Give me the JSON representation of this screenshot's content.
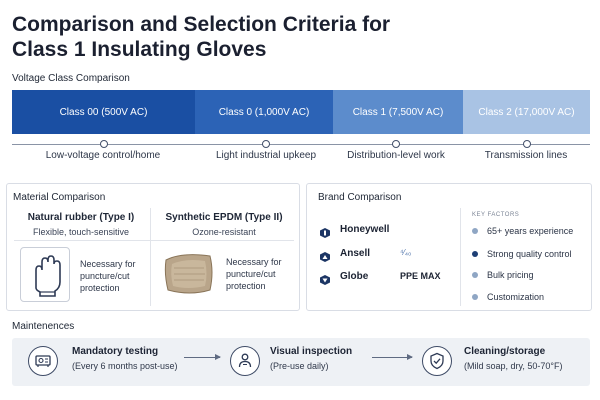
{
  "title": "Comparison and Selection Criteria for Class 1 Insulating Gloves",
  "voltage": {
    "label": "Voltage Class Comparison",
    "classes": [
      {
        "label": "Class 00 (500V AC)",
        "color": "#1a4fa3",
        "use": "Low-voltage control/home"
      },
      {
        "label": "Class 0 (1,000V AC)",
        "color": "#2c63b6",
        "use": "Light industrial upkeep"
      },
      {
        "label": "Class 1 (7,500V AC)",
        "color": "#5c8ccc",
        "use": "Distribution-level work"
      },
      {
        "label": "Class 2 (17,000V AC)",
        "color": "#a9c3e4",
        "use": "Transmission lines"
      }
    ]
  },
  "material": {
    "label": "Material Comparison",
    "types": [
      {
        "name": "Natural rubber (Type I)",
        "property": "Flexible, touch-sensitive",
        "icon": "glove-icon",
        "note": [
          "Necessary for",
          "puncture/cut",
          "protection"
        ]
      },
      {
        "name": "Synthetic EPDM (Type II)",
        "property": "Ozone-resistant",
        "icon": "fabric-swatch-icon",
        "note": [
          "Necessary for",
          "puncture/cut",
          "protection"
        ]
      }
    ]
  },
  "brands": {
    "label": "Brand Comparison",
    "items": [
      {
        "name": "Honeywell",
        "icon": "honeywell-logo-icon",
        "extra": ""
      },
      {
        "name": "Ansell",
        "icon": "ansell-logo-icon",
        "extra": "⁴⁄₄₀"
      },
      {
        "name": "Globe",
        "icon": "globe-logo-icon",
        "extra": "PPE MAX"
      }
    ],
    "key_factors_label": "KEY FACTORS",
    "key_factors": [
      {
        "text": "65+ years experience",
        "color": "#8fa6c4"
      },
      {
        "text": "Strong quality control",
        "color": "#1e3f75"
      },
      {
        "text": "Bulk pricing",
        "color": "#8fa6c4"
      },
      {
        "text": "Customization",
        "color": "#8fa6c4"
      }
    ]
  },
  "maintenance": {
    "label": "Maintenences",
    "steps": [
      {
        "title": "Mandatory testing",
        "subtitle": "(Every 6 months post-use)",
        "icon": "test-equipment-icon"
      },
      {
        "title": "Visual inspection",
        "subtitle": "(Pre-use daily)",
        "icon": "inspection-person-icon"
      },
      {
        "title": "Cleaning/storage",
        "subtitle": "(Mild soap, dry, 50-70°F)",
        "icon": "shield-check-icon"
      }
    ]
  }
}
